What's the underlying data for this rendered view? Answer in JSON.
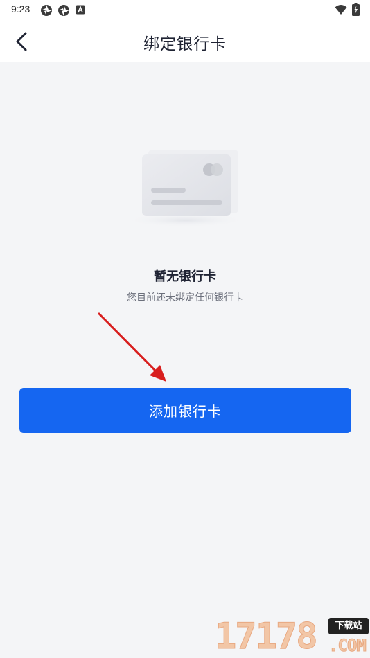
{
  "status_bar": {
    "time": "9:23",
    "left_icons": [
      "aperture-icon",
      "aperture-icon",
      "a-badge-icon"
    ],
    "right_icons": [
      "wifi-icon",
      "battery-charging-icon"
    ]
  },
  "header": {
    "title": "绑定银行卡",
    "back_icon": "chevron-left-icon"
  },
  "empty_state": {
    "illustration_icon": "bank-card-icon",
    "title": "暂无银行卡",
    "subtitle": "您目前还未绑定任何银行卡"
  },
  "actions": {
    "add_card_label": "添加银行卡"
  },
  "watermark": {
    "digits": "17178",
    "tag": "下载站",
    "com": ".COM"
  },
  "colors": {
    "primary": "#1566f1",
    "background": "#f4f5f7",
    "title_text": "#1f2333",
    "subtitle_text": "#6b6f7b",
    "annotation_arrow": "#d81e1e"
  }
}
